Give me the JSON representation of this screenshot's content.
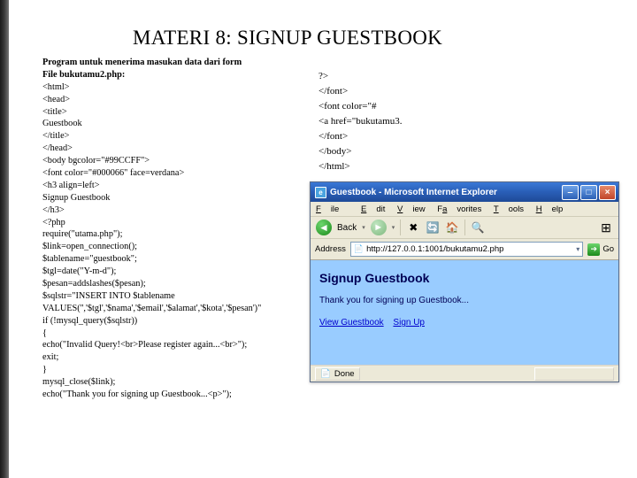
{
  "title": "MATERI 8: SIGNUP GUESTBOOK",
  "code": {
    "header1": "Program untuk menerima masukan data dari form",
    "header2": "File bukutamu2.php:",
    "lines": [
      "<html>",
      "<head>",
      "<title>",
      "Guestbook",
      "</title>",
      "</head>",
      "<body bgcolor=\"#99CCFF\">",
      "<font color=\"#000066\" face=verdana>",
      "<h3 align=left>",
      "Signup Guestbook",
      "</h3>",
      "<?php",
      "require(\"utama.php\");",
      "$link=open_connection();",
      "$tablename=\"guestbook\";",
      "$tgl=date(\"Y-m-d\");",
      "$pesan=addslashes($pesan);",
      "$sqlstr=\"INSERT INTO $tablename",
      "VALUES('','$tgl','$nama','$email','$alamat','$kota','$pesan')\"",
      "if (!mysql_query($sqlstr))",
      "{",
      "echo(\"Invalid Query!<br>Please register again...<br>\");",
      "exit;",
      "}",
      "mysql_close($link);",
      "echo(\"Thank you for signing up Guestbook...<p>\");"
    ],
    "right": [
      "?>",
      "</font>",
      "<font color=\"#",
      "<a href=\"bukutamu3.",
      "</font>",
      "</body>",
      "</html>"
    ]
  },
  "ie": {
    "title": "Guestbook - Microsoft Internet Explorer",
    "menu": {
      "file": "File",
      "edit": "Edit",
      "view": "View",
      "fav": "Favorites",
      "tools": "Tools",
      "help": "Help"
    },
    "toolbar": {
      "back": "Back"
    },
    "address": {
      "label": "Address",
      "url": "http://127.0.0.1:1001/bukutamu2.php",
      "go": "Go"
    },
    "page": {
      "heading": "Signup Guestbook",
      "thankyou": "Thank you for signing up Guestbook...",
      "link1": "View Guestbook",
      "link2": "Sign Up"
    },
    "status": {
      "done": "Done"
    }
  }
}
